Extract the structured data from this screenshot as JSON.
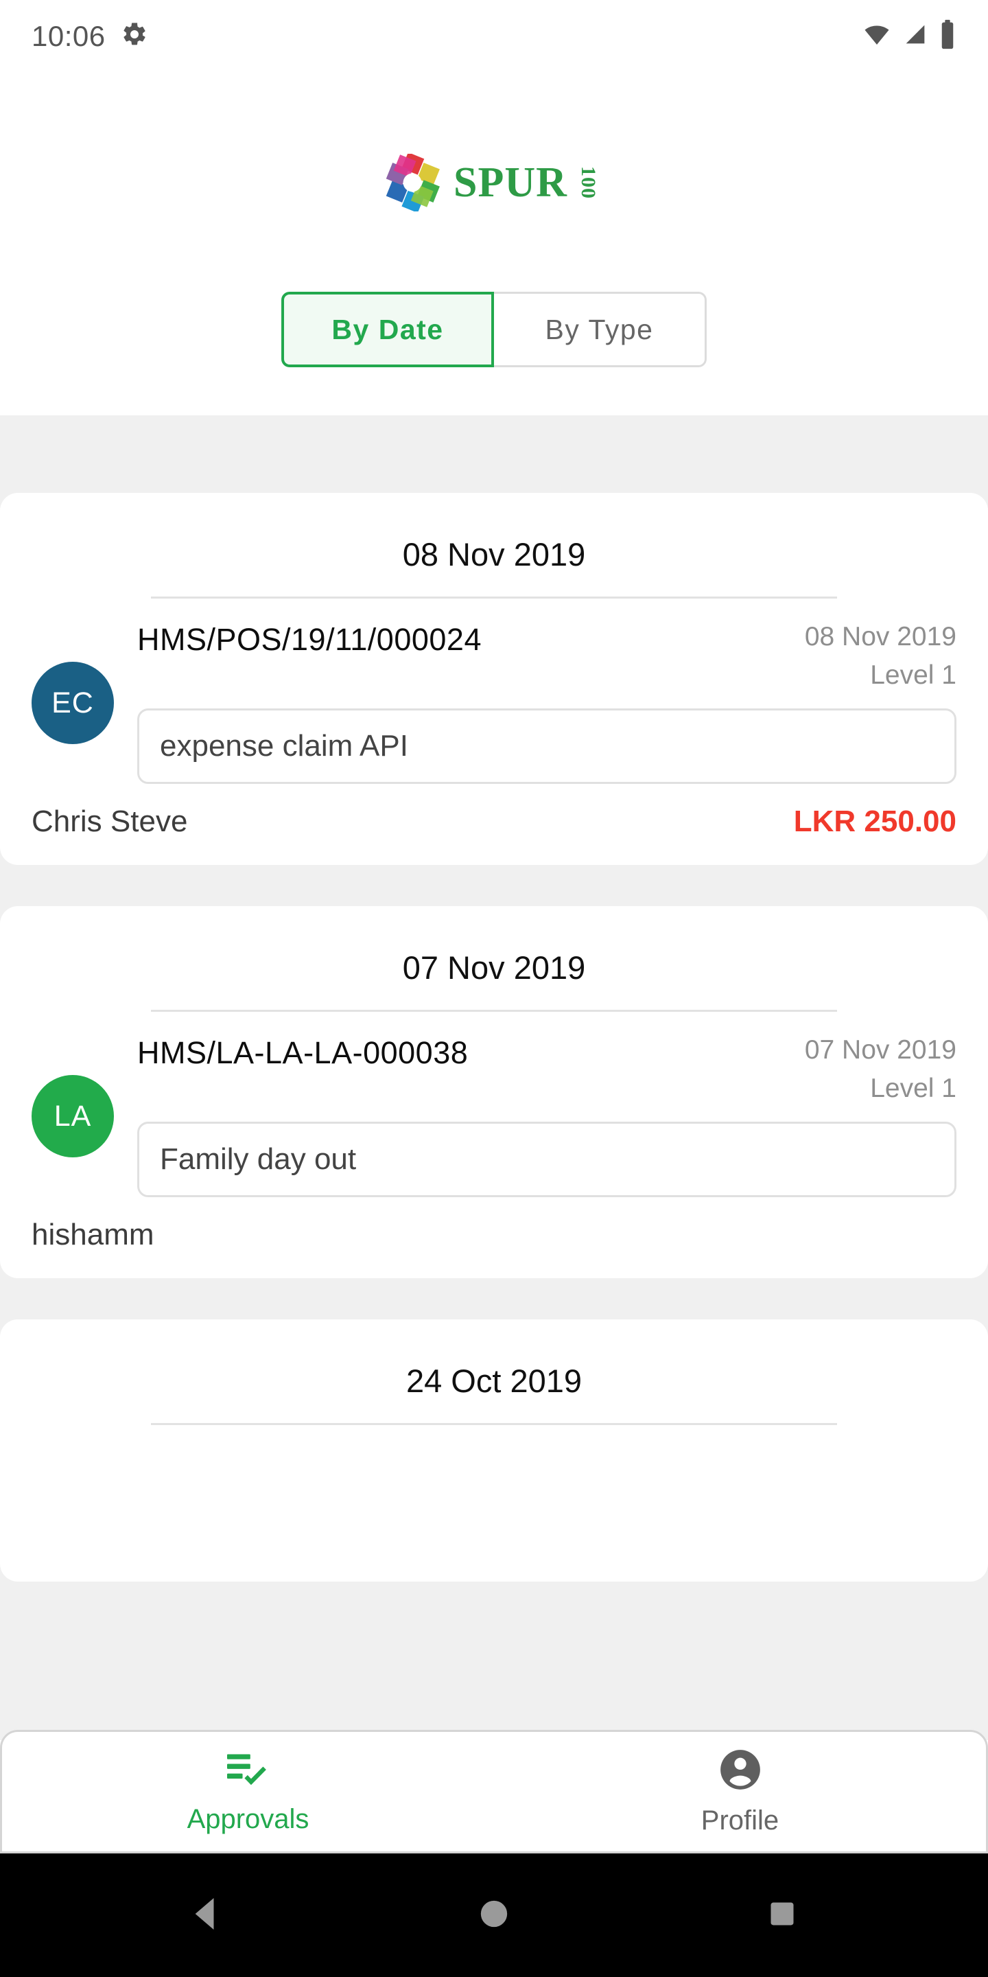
{
  "statusbar": {
    "time": "10:06",
    "icons": [
      "gear-icon",
      "wifi-icon",
      "cellular-signal-icon",
      "battery-icon"
    ]
  },
  "brand": {
    "name": "SPUR",
    "suffix": "100",
    "color": "#2e9b46",
    "logo_icon": "spur-pinwheel-logo"
  },
  "segmented_control": {
    "options": [
      {
        "label": "By Date",
        "selected": true
      },
      {
        "label": "By Type",
        "selected": false
      }
    ],
    "active_color": "#22a84d",
    "active_bg": "#f1faf3",
    "inactive_color": "#666666"
  },
  "groups": [
    {
      "date_header": "08 Nov 2019",
      "items": [
        {
          "avatar_initials": "EC",
          "avatar_color": "#1a6085",
          "reference": "HMS/POS/19/11/000024",
          "date": "08 Nov 2019",
          "level": "Level 1",
          "description": "expense claim API",
          "person": "Chris Steve",
          "amount": "LKR 250.00",
          "amount_color": "#f0392b"
        }
      ]
    },
    {
      "date_header": "07 Nov 2019",
      "items": [
        {
          "avatar_initials": "LA",
          "avatar_color": "#22ab4b",
          "reference": "HMS/LA-LA-LA-000038",
          "date": "07 Nov 2019",
          "level": "Level 1",
          "description": "Family day out",
          "person": "hishamm",
          "amount": "",
          "amount_color": "#f0392b"
        }
      ]
    },
    {
      "date_header": "24 Oct 2019",
      "items": []
    }
  ],
  "bottom_nav": {
    "items": [
      {
        "label": "Approvals",
        "icon": "playlist-check-icon",
        "active": true,
        "color": "#22a84d"
      },
      {
        "label": "Profile",
        "icon": "account-circle-icon",
        "active": false,
        "color": "#666666"
      }
    ]
  },
  "system_nav": {
    "back": "back-triangle-icon",
    "home": "home-circle-icon",
    "recents": "recents-square-icon"
  }
}
